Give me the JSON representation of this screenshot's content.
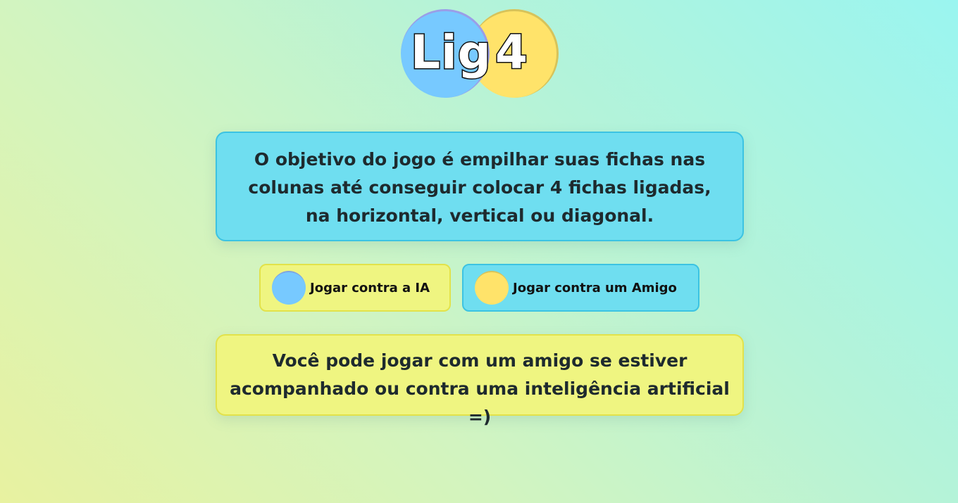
{
  "logo": {
    "part1": "Lig",
    "part2": "4",
    "colors": {
      "blue_chip": "#77c9ff",
      "yellow_chip": "#ffe36a"
    }
  },
  "objective_text": "O objetivo do jogo é empilhar suas fichas nas colunas até conseguir colocar 4 fichas ligadas, na horizontal, vertical ou diagonal.",
  "buttons": {
    "vs_ai": {
      "label": "Jogar contra a IA",
      "chip": "blue-chip-icon"
    },
    "vs_friend": {
      "label": "Jogar contra um Amigo",
      "chip": "yellow-chip-icon"
    }
  },
  "info_text": "Você pode jogar com um amigo se estiver acompanhado ou contra uma inteligência artificial =)",
  "theme": {
    "cyan_panel": "#6fdef0",
    "yellow_panel": "#eff581"
  }
}
